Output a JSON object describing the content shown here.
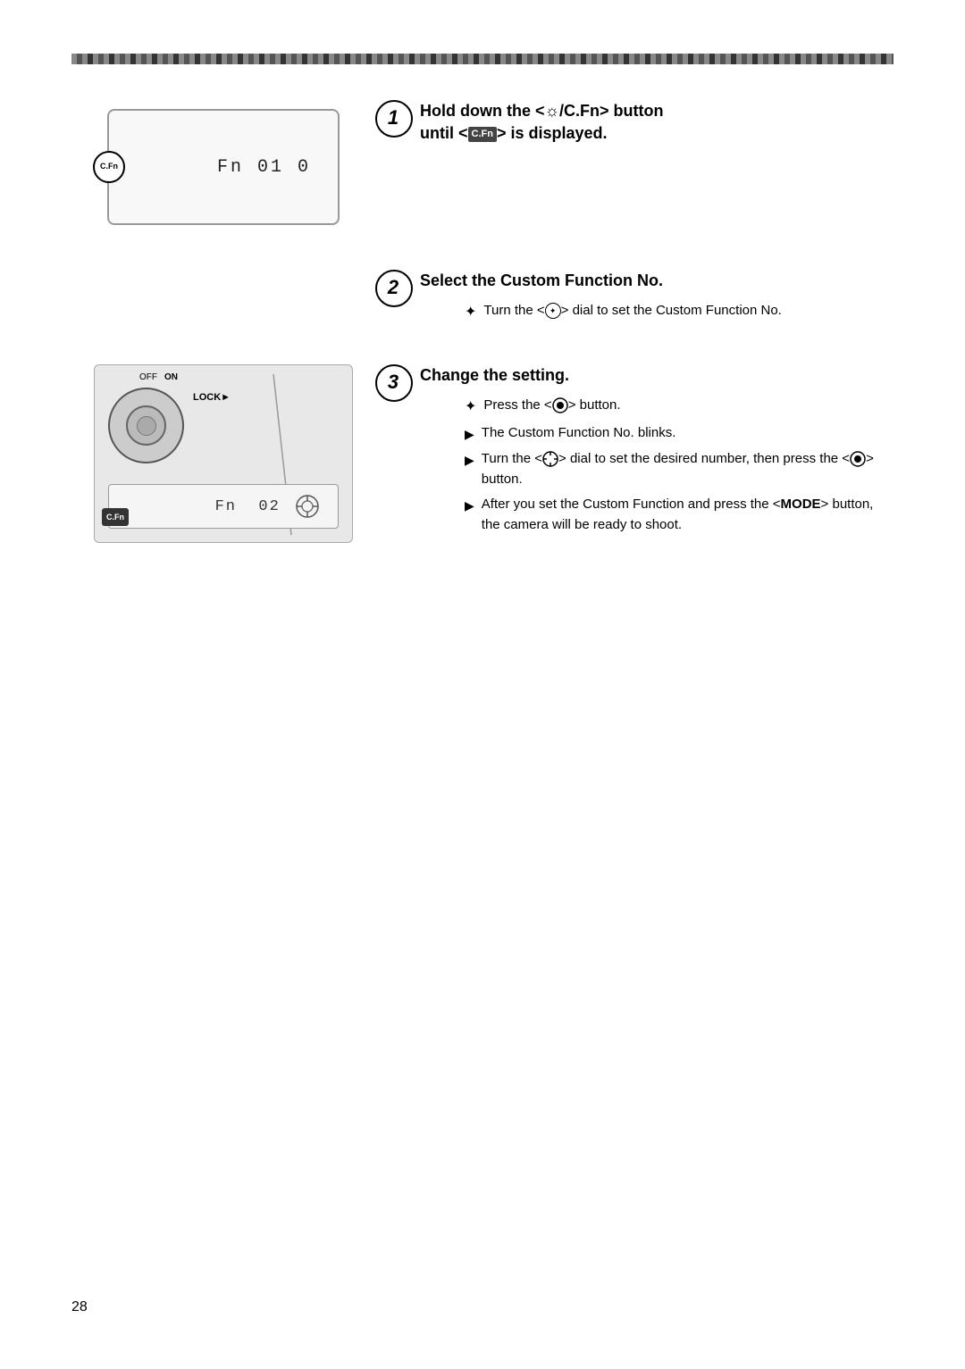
{
  "page": {
    "number": "28",
    "top_bar_visible": true
  },
  "step1": {
    "number": "1",
    "title": "Hold down the <",
    "title_icon": "sun-cfn-icon",
    "title_middle": "/C.Fn",
    "title_end": "> button",
    "title_line2": "until <",
    "title_badge": "C.Fn",
    "title_line2_end": "> is displayed."
  },
  "step2": {
    "number": "2",
    "title": "Select the Custom Function No.",
    "bullets": [
      {
        "type": "star",
        "text": "Turn the <○> dial to set the Custom Function No."
      }
    ]
  },
  "step3": {
    "number": "3",
    "title": "Change the setting.",
    "bullets": [
      {
        "type": "star",
        "text": "Press the <⊙> button."
      },
      {
        "type": "arrow",
        "text": "The Custom Function No. blinks."
      },
      {
        "type": "arrow",
        "text": "Turn the <○> dial to set the desired number, then press the <⊙> button."
      },
      {
        "type": "arrow",
        "text": "After you set the Custom Function and press the <MODE> button, the camera will be ready to shoot."
      }
    ]
  },
  "diagram1": {
    "lcd_text": "Fn  01  0",
    "cfn_label": "C.Fn"
  },
  "diagram2": {
    "lcd_text": "Fn  02",
    "cfn_label": "C.Fn",
    "off_label": "OFF",
    "on_label": "ON",
    "lock_label": "LOCK►"
  }
}
